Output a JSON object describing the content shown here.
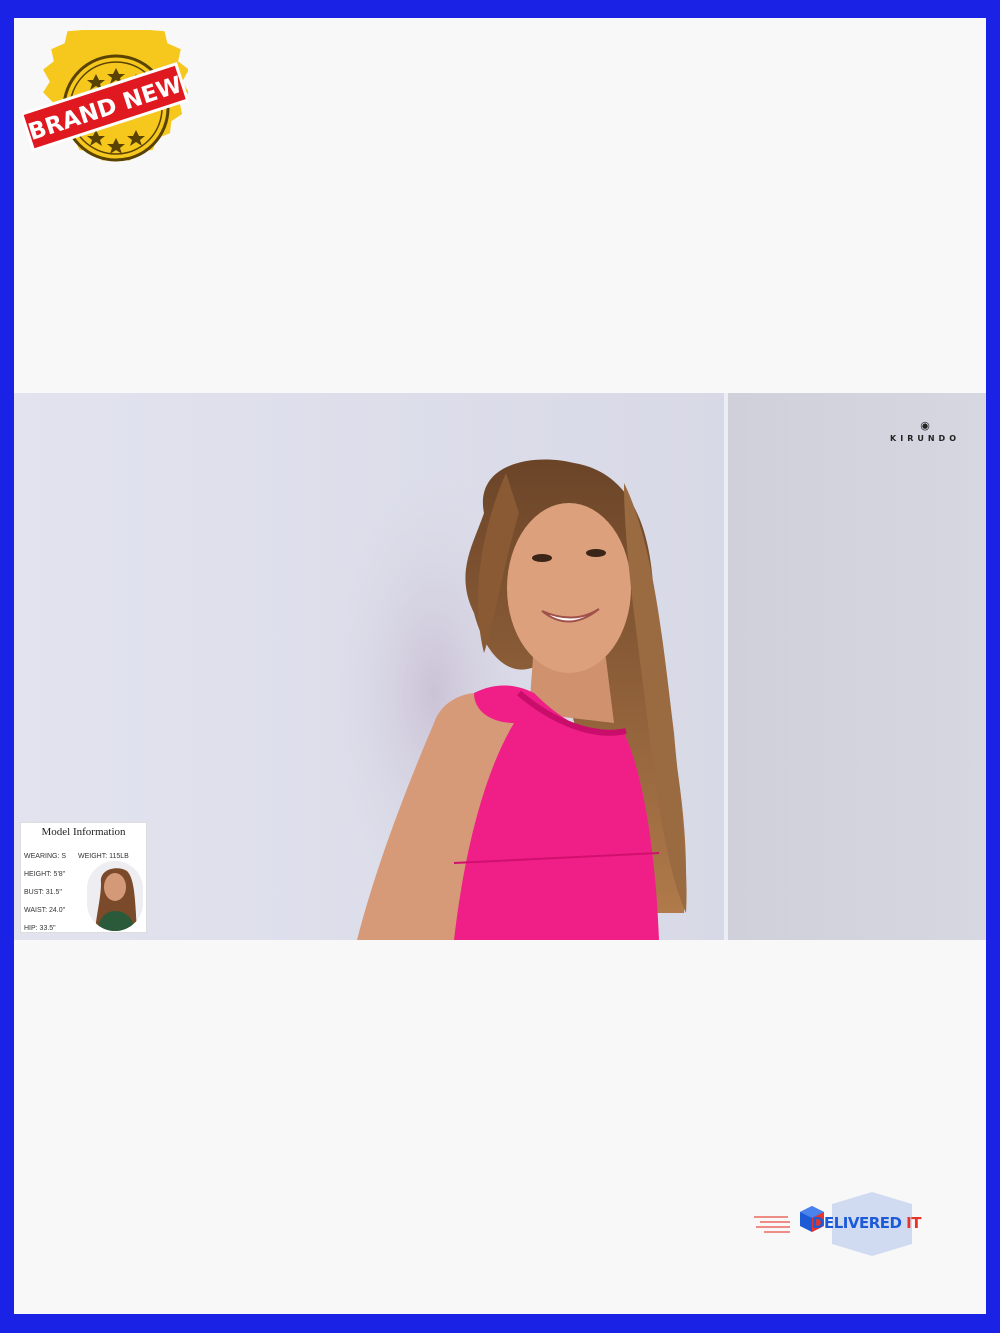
{
  "badge": {
    "text": "BRAND NEW",
    "colors": {
      "seal": "#f6c81e",
      "ribbon": "#e0181f",
      "text": "#ffffff"
    },
    "icon": "star-seal-icon"
  },
  "photo": {
    "brand_mark": "KIRUNDO",
    "colors": {
      "top": "#f8c8dc",
      "wall": "#dcdde8"
    }
  },
  "model_info": {
    "title": "Model Information",
    "rows": [
      "WEARING: S",
      "HEIGHT: 5'8\"",
      "BUST: 31.5\"",
      "WAIST: 24.0\"",
      "HIP: 33.5\""
    ],
    "weight": "WEIGHT: 115LB"
  },
  "delivered_logo": {
    "text_main": "DELIVERED",
    "text_suffix": " IT",
    "colors": {
      "blue": "#1d5bd6",
      "red": "#e8352a"
    }
  },
  "colors": {
    "border": "#1a22e6",
    "canvas": "#f8f8f8"
  }
}
